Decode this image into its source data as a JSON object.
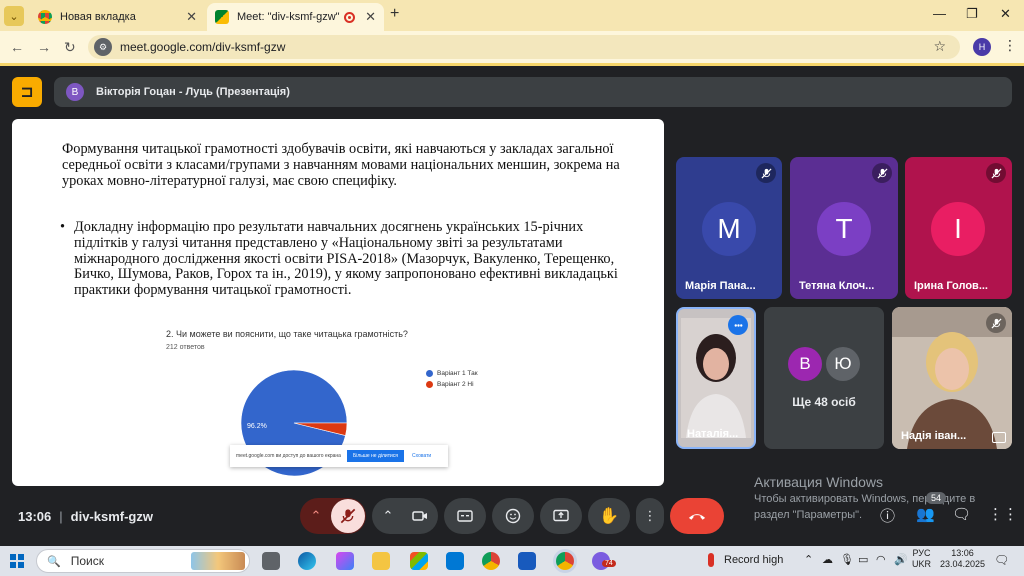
{
  "browser": {
    "tabs": [
      {
        "title": "Новая вкладка",
        "active": false
      },
      {
        "title": "Meet: \"div-ksmf-gzw\"",
        "active": true
      }
    ],
    "url": "meet.google.com/div-ksmf-gzw",
    "profile_initial": "Н"
  },
  "meet": {
    "presenter": {
      "initial": "В",
      "label": "Вікторія Гоцан - Луць (Презентація)"
    },
    "meeting_code": "div-ksmf-gzw",
    "time": "13:06",
    "people_count": "54"
  },
  "slide": {
    "paragraph1": "Формування читацької грамотності здобувачів освіти, які навчаються у закладах загальної середньої освіти з класами/групами з навчанням мовами національних меншин, зокрема на уроках мовно-літературної галузі, має свою специфіку.",
    "bullet": "•",
    "paragraph2": "Докладну інформацію про результати навчальних досягнень українських 15-річних підлітків у галузі читання представлено у «Національному звіті за результатами міжнародного дослідження якості освіти PISA-2018» (Мазорчук, Вакуленко, Терещенко, Бичко, Шумова, Раков, Горох та ін., 2019), у якому запропоновано ефективні викладацькі практики формування читацької грамотності.",
    "poll_question": "2. Чи можете ви пояснити, що таке читацька грамотність?",
    "poll_responses": "212 ответов",
    "share_text": "meet.google.com ви доступ до вашого екрана",
    "share_stop": "Більше не ділитися",
    "share_hide": "Сховати"
  },
  "chart_data": {
    "type": "pie",
    "labels": [
      "Варіант 1 Так",
      "Варіант 2 Ні"
    ],
    "values": [
      96.2,
      3.8
    ],
    "colors": [
      "#3366cc",
      "#dc3912"
    ],
    "slice_labels": [
      "96.2%",
      ""
    ],
    "legend": "right"
  },
  "participants": [
    {
      "name": "Марія Пана...",
      "initial": "М",
      "color": "#3949ab",
      "bg": "#2f3d8f"
    },
    {
      "name": "Тетяна Клоч...",
      "initial": "Т",
      "color": "#7b3fc4",
      "bg": "#5b2e93"
    },
    {
      "name": "Ірина Голов...",
      "initial": "І",
      "color": "#e91e63",
      "bg": "#b0134d"
    },
    {
      "name": "Наталія..."
    },
    {
      "more_initials": [
        "В",
        "Ю"
      ],
      "more_label": "Ще 48 осіб"
    },
    {
      "name": "Надія іван..."
    }
  ],
  "windows": {
    "activation_title": "Активация Windows",
    "activation_text1": "Чтобы активировать Windows, перейдите в",
    "activation_text2": "раздел \"Параметры\".",
    "search_placeholder": "Поиск",
    "record_label": "Record high",
    "lang1": "РУС",
    "lang2": "UKR",
    "clock_time": "13:06",
    "clock_date": "23.04.2025",
    "taskbar_badge": "74"
  }
}
